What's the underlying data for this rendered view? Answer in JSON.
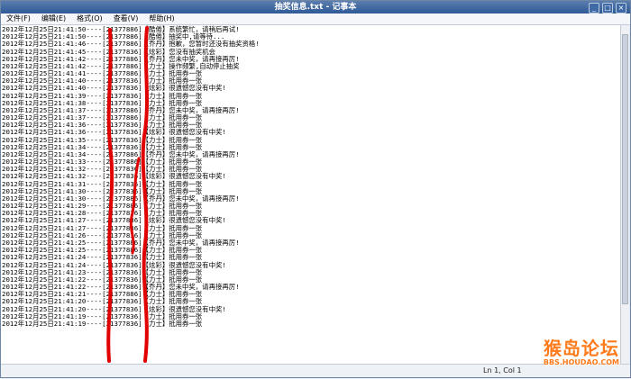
{
  "window": {
    "title": "抽奖信息.txt - 记事本",
    "controls": [
      "_",
      "□",
      "×"
    ]
  },
  "menu": [
    "文件(F)",
    "编辑(E)",
    "格式(O)",
    "查看(V)",
    "帮助(H)"
  ],
  "lines": [
    "2012年12月25日21:41:50----[21377886]【酷倦】系统繁忙，请稍后再试!",
    "2012年12月25日21:41:50----[21377886]【酷倦】抽奖中,请等待...",
    "2012年12月25日21:41:46----[21377886]【乔丹】抱歉，您暂时还没有抽奖资格!",
    "2012年12月25日21:41:45----[21377836]【炫彩】您没有抽奖机会",
    "2012年12月25日21:41:42----[21377886]【乔丹】您未中奖，请再接再厉!",
    "2012年12月25日21:41:42----[21377886]【力士】操作频繁,自动停止抽奖",
    "2012年12月25日21:41:41----[21377886]【力士】抵用券一张",
    "2012年12月25日21:41:40----[21377836]【力士】抵用券一张",
    "2012年12月25日21:41:40----[21377836]【炫彩】很遗憾您没有中奖!",
    "2012年12月25日21:41:39----[21377836]【力士】抵用券一张",
    "2012年12月25日21:41:38----[21377836]【力士】抵用券一张",
    "2012年12月25日21:41:37----[21377886]【乔丹】您未中奖，请再接再厉!",
    "2012年12月25日21:41:37----[21377886]【力士】抵用券一张",
    "2012年12月25日21:41:36----[21377836]【力士】抵用券一张",
    "2012年12月25日21:41:36----[21377836]【炫彩】很遗憾您没有中奖!",
    "2012年12月25日21:41:35----[21377836]【力士】抵用券一张",
    "2012年12月25日21:41:34----[21377836]【力士】抵用券一张",
    "2012年12月25日21:41:34----[21377886]【乔丹】您未中奖，请再接再厉!",
    "2012年12月25日21:41:33----[21377886]【力士】抵用券一张",
    "2012年12月25日21:41:32----[21377836]【力士】抵用券一张",
    "2012年12月25日21:41:32----[21377836]【炫彩】很遗憾您没有中奖!",
    "2012年12月25日21:41:31----[21377836]【力士】抵用券一张",
    "2012年12月25日21:41:30----[21377836]【力士】抵用券一张",
    "2012年12月25日21:41:30----[21377886]【乔丹】您未中奖，请再接再厉!",
    "2012年12月25日21:41:29----[21377886]【力士】抵用券一张",
    "2012年12月25日21:41:28----[21377836]【力士】抵用券一张",
    "2012年12月25日21:41:27----[21377836]【炫彩】很遗憾您没有中奖!",
    "2012年12月25日21:41:27----[21377836]【力士】抵用券一张",
    "2012年12月25日21:41:26----[21377836]【力士】抵用券一张",
    "2012年12月25日21:41:25----[21377886]【乔丹】您未中奖，请再接再厉!",
    "2012年12月25日21:41:25----[21377886]【力士】抵用券一张",
    "2012年12月25日21:41:24----[21377836]【力士】抵用券一张",
    "2012年12月25日21:41:24----[21377836]【炫彩】很遗憾您没有中奖!",
    "2012年12月25日21:41:23----[21377836]【力士】抵用券一张",
    "2012年12月25日21:41:22----[21377836]【力士】抵用券一张",
    "2012年12月25日21:41:22----[21377886]【乔丹】您未中奖，请再接再厉!",
    "2012年12月25日21:41:21----[21377886]【力士】抵用券一张",
    "2012年12月25日21:41:20----[21377836]【力士】抵用券一张",
    "2012年12月25日21:41:20----[21377836]【炫彩】很遗憾您没有中奖!",
    "2012年12月25日21:41:19----[21377836]【力士】抵用券一张",
    "2012年12月25日21:41:19----[21377836]【力士】抵用券一张"
  ],
  "status": {
    "position": "Ln 1, Col 1"
  },
  "watermark": {
    "logo": "猴岛论坛",
    "url": "BBS.HOUDAO.COM"
  },
  "colors": {
    "annotation": "#e00000",
    "watermark": "#ff7a1a"
  }
}
